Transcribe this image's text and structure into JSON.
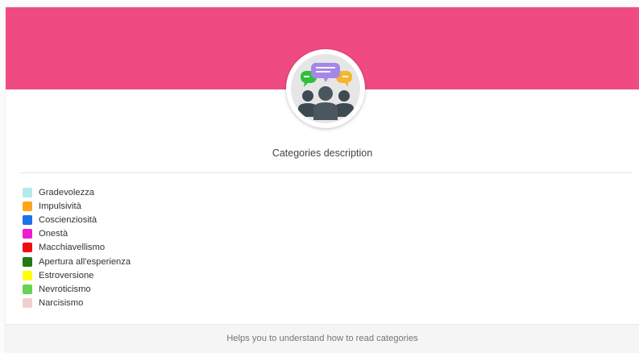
{
  "card": {
    "title": "Categories description",
    "header_color": "#ef4b82",
    "icon": "group-chat-icon"
  },
  "legend": {
    "items": [
      {
        "label": "Gradevolezza",
        "color": "#b2ebea"
      },
      {
        "label": "Impulsività",
        "color": "#ffa51a"
      },
      {
        "label": "Coscienziosità",
        "color": "#1a73e8"
      },
      {
        "label": "Onestà",
        "color": "#f01cd0"
      },
      {
        "label": "Macchiavellismo",
        "color": "#f40c0c"
      },
      {
        "label": "Apertura all'esperienza",
        "color": "#217a12"
      },
      {
        "label": "Estroversione",
        "color": "#ffff00"
      },
      {
        "label": "Nevroticismo",
        "color": "#66d44f"
      },
      {
        "label": "Narcisismo",
        "color": "#f2cfcf"
      }
    ]
  },
  "footer": {
    "text": "Helps you to understand how to read categories"
  }
}
